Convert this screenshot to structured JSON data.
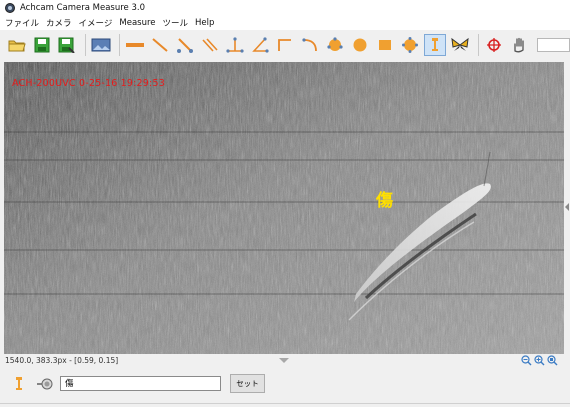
{
  "window": {
    "title": "Achcam Camera Measure 3.0"
  },
  "menu": [
    "ファイル",
    "カメラ",
    "イメージ",
    "Measure",
    "ツール",
    "Help"
  ],
  "toolbar": {
    "buttons": [
      "open-folder-icon",
      "save-icon",
      "save-as-icon",
      "image-icon",
      "thick-line-icon",
      "line-icon",
      "angle-line-icon",
      "parallel-lines-icon",
      "perpendicular-icon",
      "angle-icon",
      "polyline-icon",
      "arc-icon",
      "circle-icon",
      "filled-circle-icon",
      "rectangle-icon",
      "gear-shape-icon",
      "text-marker-icon",
      "butterfly-icon",
      "crosshair-icon",
      "hand-icon"
    ],
    "active": "text-marker-icon"
  },
  "viewer": {
    "overlay_text": "ACH-200UVC 0-25-16  19:29:53",
    "defect_label": "傷",
    "overlay_color": "#e51c1c",
    "label_color": "#ffe000"
  },
  "status": {
    "coords": "1540.0, 383.3px - [0.59, 0.15]"
  },
  "zoom": [
    "zoom-out-icon",
    "zoom-in-icon",
    "zoom-fit-icon"
  ],
  "annotation": {
    "input_value": "傷",
    "set_label": "セット"
  }
}
